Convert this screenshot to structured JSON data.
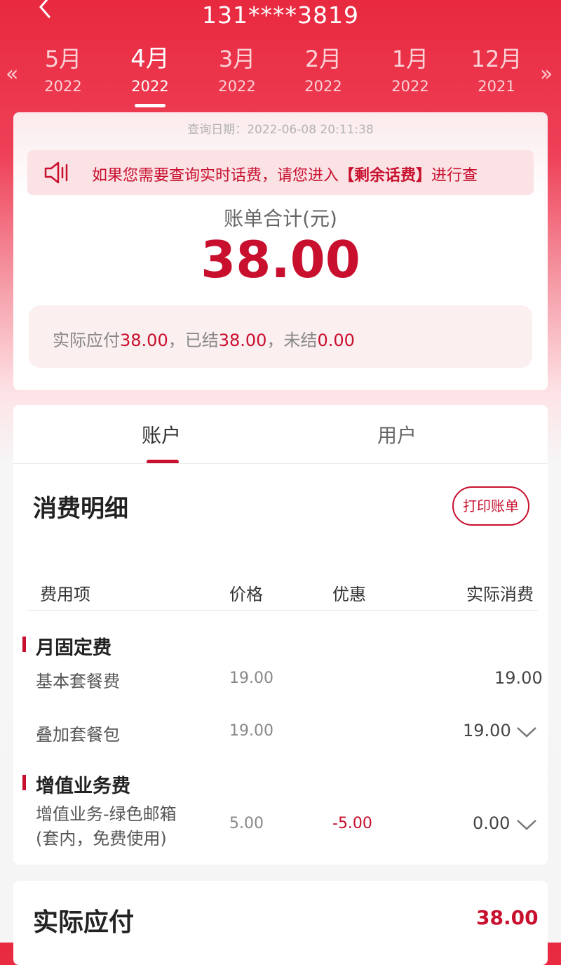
{
  "header": {
    "phone": "131****3819",
    "months": [
      {
        "month": "5月",
        "year": "2022"
      },
      {
        "month": "4月",
        "year": "2022"
      },
      {
        "month": "3月",
        "year": "2022"
      },
      {
        "month": "2月",
        "year": "2022"
      },
      {
        "month": "1月",
        "year": "2022"
      },
      {
        "month": "12月",
        "year": "2021"
      }
    ],
    "active_month_index": 1,
    "prev_arrow": "«",
    "next_arrow": "»"
  },
  "summary": {
    "query_date": "查询日期：2022-06-08 20:11:38",
    "notice_prefix": "如果您需要查询实时话费，请您进入",
    "notice_highlight": "【剩余话费】",
    "notice_suffix": "进行查",
    "total_label": "账单合计(元)",
    "total_value": "38.00",
    "payable_label": "实际应付",
    "payable_value": "38.00",
    "settled_label": "，已结",
    "settled_value": "38.00",
    "unsettled_label": "，未结",
    "unsettled_value": "0.00"
  },
  "tabs": {
    "account": "账户",
    "user": "用户"
  },
  "details": {
    "title": "消费明细",
    "print_button": "打印账单",
    "columns": [
      "费用项",
      "价格",
      "优惠",
      "实际消费"
    ],
    "groups": [
      {
        "name": "月固定费",
        "items": [
          {
            "name": "基本套餐费",
            "price": "19.00",
            "discount": "",
            "actual": "19.00"
          },
          {
            "name": "叠加套餐包",
            "price": "19.00",
            "discount": "",
            "actual": "19.00"
          }
        ]
      },
      {
        "name": "增值业务费",
        "items": [
          {
            "name": "增值业务-绿色邮箱",
            "name2": "(套内，免费使用)",
            "price": "5.00",
            "discount": "-5.00",
            "actual": "0.00"
          }
        ]
      }
    ]
  },
  "footer": {
    "label": "实际应付",
    "value": "38.00"
  },
  "colors": {
    "brand": "#e8293f",
    "accent": "#c8102e"
  }
}
